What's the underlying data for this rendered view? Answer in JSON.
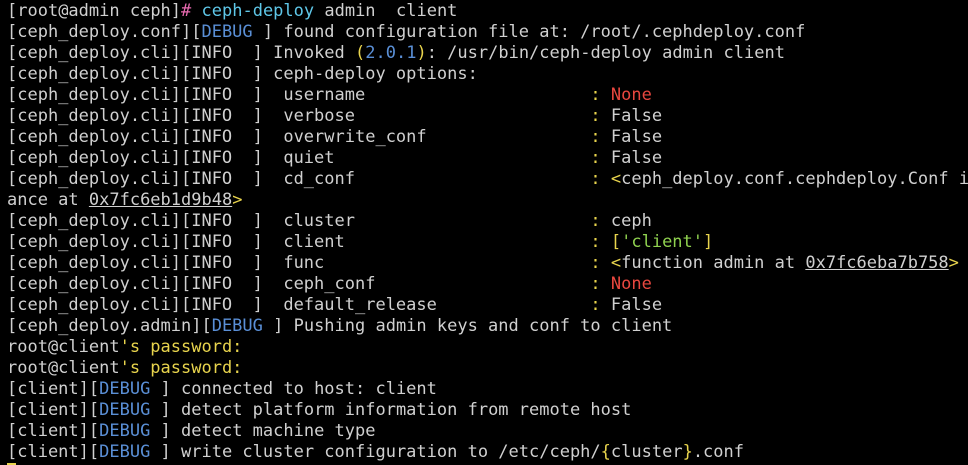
{
  "terminal": {
    "prompt": {
      "open": "[",
      "user_host": "root@admin",
      "cwd": " ceph",
      "close": "]",
      "symbol": "# ",
      "command": "ceph-deploy",
      "args": " admin  client"
    },
    "log_lines": [
      {
        "segments": [
          {
            "t": "[ceph_deploy.conf][",
            "c": "default"
          },
          {
            "t": "DEBUG",
            "c": "blue"
          },
          {
            "t": " ] found configuration file at: /root/.cephdeploy.conf",
            "c": "default"
          }
        ]
      },
      {
        "segments": [
          {
            "t": "[ceph_deploy.cli][",
            "c": "default"
          },
          {
            "t": "INFO",
            "c": "default"
          },
          {
            "t": "  ] Invoked ",
            "c": "default"
          },
          {
            "t": "(",
            "c": "yellow"
          },
          {
            "t": "2.0.1",
            "c": "blue"
          },
          {
            "t": ")",
            "c": "yellow"
          },
          {
            "t": ": /usr/bin/ceph-deploy admin client",
            "c": "default"
          }
        ]
      },
      {
        "segments": [
          {
            "t": "[ceph_deploy.cli][INFO  ] ceph-deploy options:",
            "c": "default"
          }
        ]
      },
      {
        "segments": [
          {
            "t": "[ceph_deploy.cli][INFO  ]  username                      ",
            "c": "default"
          },
          {
            "t": ": ",
            "c": "yellow"
          },
          {
            "t": "None",
            "c": "red"
          }
        ]
      },
      {
        "segments": [
          {
            "t": "[ceph_deploy.cli][INFO  ]  verbose                       ",
            "c": "default"
          },
          {
            "t": ": ",
            "c": "yellow"
          },
          {
            "t": "False",
            "c": "default"
          }
        ]
      },
      {
        "segments": [
          {
            "t": "[ceph_deploy.cli][INFO  ]  overwrite_conf                ",
            "c": "default"
          },
          {
            "t": ": ",
            "c": "yellow"
          },
          {
            "t": "False",
            "c": "default"
          }
        ]
      },
      {
        "segments": [
          {
            "t": "[ceph_deploy.cli][INFO  ]  quiet                         ",
            "c": "default"
          },
          {
            "t": ": ",
            "c": "yellow"
          },
          {
            "t": "False",
            "c": "default"
          }
        ]
      },
      {
        "segments": [
          {
            "t": "[ceph_deploy.cli][INFO  ]  cd_conf                       ",
            "c": "default"
          },
          {
            "t": ": ",
            "c": "yellow"
          },
          {
            "t": "<",
            "c": "yellow"
          },
          {
            "t": "ceph_deploy.conf.cephdeploy.Conf inst",
            "c": "default"
          }
        ]
      },
      {
        "segments": [
          {
            "t": "ance at ",
            "c": "default"
          },
          {
            "t": "0x7fc6eb1d9b48",
            "c": "default",
            "u": true
          },
          {
            "t": ">",
            "c": "yellow"
          }
        ]
      },
      {
        "segments": [
          {
            "t": "[ceph_deploy.cli][INFO  ]  cluster                       ",
            "c": "default"
          },
          {
            "t": ": ",
            "c": "yellow"
          },
          {
            "t": "ceph",
            "c": "default"
          }
        ]
      },
      {
        "segments": [
          {
            "t": "[ceph_deploy.cli][INFO  ]  client                        ",
            "c": "default"
          },
          {
            "t": ": ",
            "c": "yellow"
          },
          {
            "t": "[",
            "c": "yellow"
          },
          {
            "t": "'client'",
            "c": "green"
          },
          {
            "t": "]",
            "c": "yellow"
          }
        ]
      },
      {
        "segments": [
          {
            "t": "[ceph_deploy.cli][INFO  ]  func                          ",
            "c": "default"
          },
          {
            "t": ": ",
            "c": "yellow"
          },
          {
            "t": "<",
            "c": "yellow"
          },
          {
            "t": "function admin at ",
            "c": "default"
          },
          {
            "t": "0x7fc6eba7b758",
            "c": "default",
            "u": true
          },
          {
            "t": ">",
            "c": "yellow"
          }
        ]
      },
      {
        "segments": [
          {
            "t": "[ceph_deploy.cli][INFO  ]  ceph_conf                     ",
            "c": "default"
          },
          {
            "t": ": ",
            "c": "yellow"
          },
          {
            "t": "None",
            "c": "red"
          }
        ]
      },
      {
        "segments": [
          {
            "t": "[ceph_deploy.cli][INFO  ]  default_release               ",
            "c": "default"
          },
          {
            "t": ": ",
            "c": "yellow"
          },
          {
            "t": "False",
            "c": "default"
          }
        ]
      },
      {
        "segments": [
          {
            "t": "[ceph_deploy.admin][",
            "c": "default"
          },
          {
            "t": "DEBUG",
            "c": "blue"
          },
          {
            "t": " ] Pushing admin keys and conf to client",
            "c": "default"
          }
        ]
      },
      {
        "segments": [
          {
            "t": "root@client",
            "c": "default"
          },
          {
            "t": "'s password:",
            "c": "yellow"
          }
        ]
      },
      {
        "segments": [
          {
            "t": "root@client",
            "c": "default"
          },
          {
            "t": "'s password:",
            "c": "yellow"
          }
        ]
      },
      {
        "segments": [
          {
            "t": "[client][",
            "c": "default"
          },
          {
            "t": "DEBUG",
            "c": "blue"
          },
          {
            "t": " ] connected to host: client",
            "c": "default"
          }
        ]
      },
      {
        "segments": [
          {
            "t": "[client][",
            "c": "default"
          },
          {
            "t": "DEBUG",
            "c": "blue"
          },
          {
            "t": " ] detect platform information from remote host",
            "c": "default"
          }
        ]
      },
      {
        "segments": [
          {
            "t": "[client][",
            "c": "default"
          },
          {
            "t": "DEBUG",
            "c": "blue"
          },
          {
            "t": " ] detect machine type",
            "c": "default"
          }
        ]
      },
      {
        "segments": [
          {
            "t": "[client][",
            "c": "default"
          },
          {
            "t": "DEBUG",
            "c": "blue"
          },
          {
            "t": " ] write cluster configuration to /etc/ceph/",
            "c": "default"
          },
          {
            "t": "{",
            "c": "yellow"
          },
          {
            "t": "cluster",
            "c": "default"
          },
          {
            "t": "}",
            "c": "yellow"
          },
          {
            "t": ".conf",
            "c": "default"
          }
        ]
      }
    ]
  },
  "colors": {
    "background": "#000000",
    "default": "#d0d0d0",
    "blue": "#5a8fd6",
    "green": "#8fd14f",
    "yellow": "#e8d44d",
    "red": "#e8473f",
    "pink": "#e86ab0",
    "cyan": "#5fc7e8"
  }
}
